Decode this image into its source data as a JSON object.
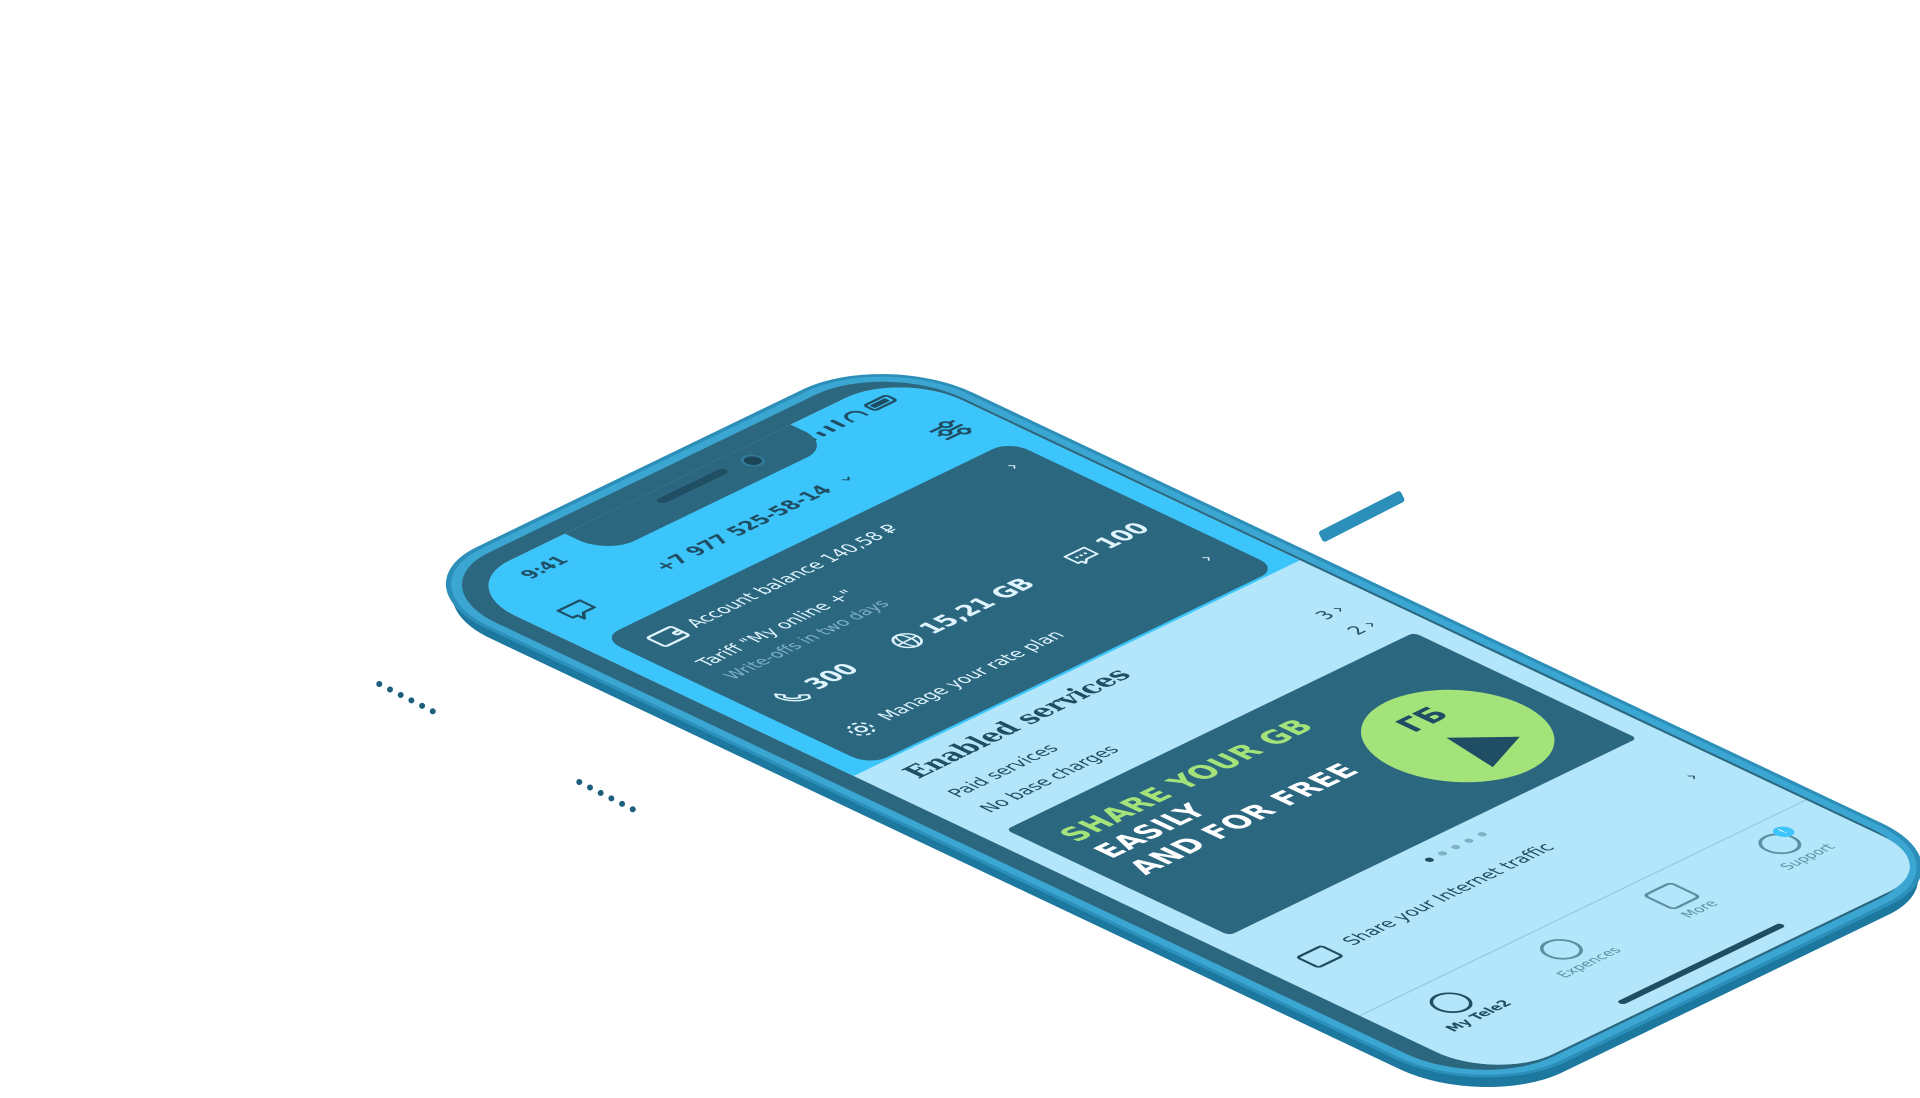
{
  "status_bar": {
    "time": "9:41"
  },
  "header": {
    "phone_number": "+7 977 525-58-14",
    "left_icon": "chat-bubble-icon",
    "right_icon": "sliders-icon"
  },
  "account": {
    "balance_label": "Account balance 140,58 ₽",
    "tariff_name": "Tariff \"My online +\"",
    "tariff_sub": "Write-offs in two days",
    "quotas": [
      {
        "icon": "phone-icon",
        "value": "300"
      },
      {
        "icon": "globe-icon",
        "value": "15,21 GB"
      },
      {
        "icon": "message-icon",
        "value": "100"
      }
    ],
    "manage_label": "Manage your rate plan"
  },
  "services": {
    "title": "Enabled services",
    "items": [
      {
        "label": "Paid services",
        "count": "3"
      },
      {
        "label": "No base charges",
        "count": "2"
      }
    ]
  },
  "banner": {
    "line1": "SHARE YOUR GB",
    "line2": "EASILY",
    "line3": "AND FOR FREE",
    "badge": "ГБ"
  },
  "share": {
    "label": "Share your Internet traffic"
  },
  "tabs": [
    {
      "label": "My Tele2",
      "icon": "user-icon"
    },
    {
      "label": "Expences",
      "icon": "ruble-icon"
    },
    {
      "label": "More",
      "icon": "grid-icon"
    },
    {
      "label": "Support",
      "icon": "support-icon",
      "badge": "!"
    }
  ],
  "colors": {
    "phone_body": "#3aa6d1",
    "accent_blue": "#3cc5fa",
    "card_dark": "#2c6780",
    "screen_light": "#b3e6fa",
    "banner_green": "#a4e27a"
  }
}
